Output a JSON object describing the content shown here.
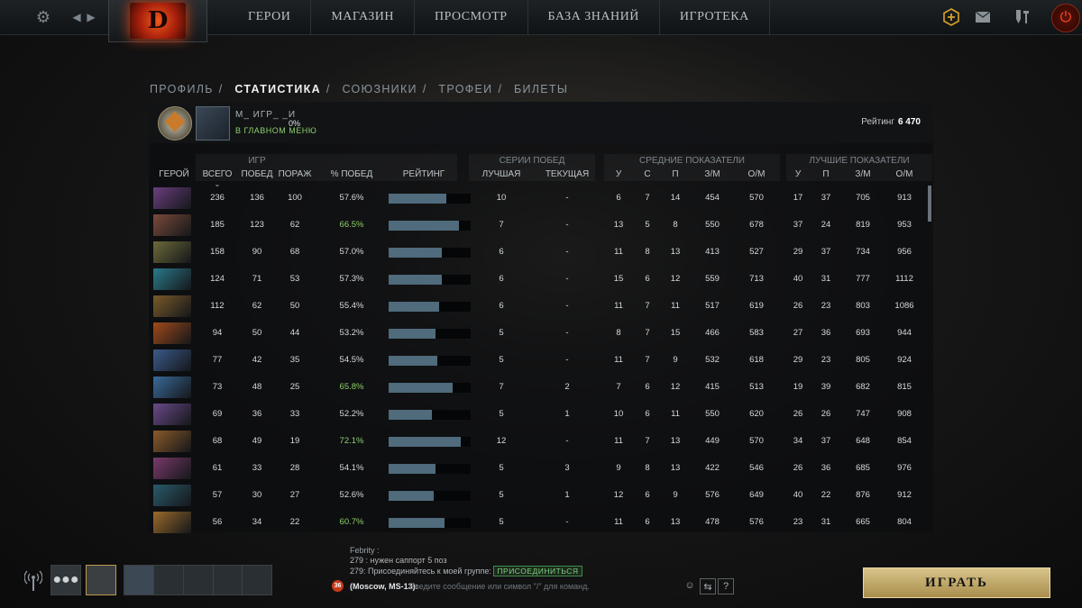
{
  "nav": {
    "items": [
      "ГЕРОИ",
      "МАГАЗИН",
      "ПРОСМОТР",
      "БАЗА ЗНАНИЙ",
      "ИГРОТЕКА"
    ]
  },
  "tabs": [
    "ПРОФИЛЬ",
    "СТАТИСТИКА",
    "СОЮЗНИКИ",
    "ТРОФЕИ",
    "БИЛЕТЫ"
  ],
  "active_tab": "СТАТИСТИКА",
  "profile": {
    "name_fragment": "М_ ИГР_ _И",
    "percent": "0%",
    "status": "В ГЛАВНОМ МЕНЮ",
    "rating_label": "Рейтинг",
    "rating_value": "6 470"
  },
  "groups": {
    "games": "ИГР",
    "streaks": "СЕРИИ ПОБЕД",
    "avg": "СРЕДНИЕ ПОКАЗАТЕЛИ",
    "best": "ЛУЧШИЕ ПОКАЗАТЕЛИ"
  },
  "headers": {
    "hero": "ГЕРОЙ",
    "total": "ВСЕГО",
    "wins": "ПОБЕД",
    "losses": "ПОРАЖ",
    "winrate": "% ПОБЕД",
    "rating": "РЕЙТИНГ",
    "best": "ЛУЧШАЯ",
    "current": "ТЕКУЩАЯ",
    "avg_k": "У",
    "avg_d": "С",
    "avg_a": "П",
    "avg_gpm": "З/М",
    "avg_xpm": "О/М",
    "best_k": "У",
    "best_a": "П",
    "best_gpm": "З/М",
    "best_xpm": "О/М"
  },
  "rows": [
    {
      "total": "236",
      "wins": "136",
      "losses": "100",
      "winrate": "57.6%",
      "rating": 0.7,
      "best": "10",
      "cur": "-",
      "k": "6",
      "d": "7",
      "a": "14",
      "gpm": "454",
      "xpm": "570",
      "bk": "17",
      "ba": "37",
      "bg": "705",
      "bx": "913",
      "hero_color": "#6a3f7e"
    },
    {
      "total": "185",
      "wins": "123",
      "losses": "62",
      "winrate": "66.5%",
      "rating": 0.86,
      "best": "7",
      "cur": "-",
      "k": "13",
      "d": "5",
      "a": "8",
      "gpm": "550",
      "xpm": "678",
      "bk": "37",
      "ba": "24",
      "bg": "819",
      "bx": "953",
      "hero_color": "#7a4a3a"
    },
    {
      "total": "158",
      "wins": "90",
      "losses": "68",
      "winrate": "57.0%",
      "rating": 0.65,
      "best": "6",
      "cur": "-",
      "k": "11",
      "d": "8",
      "a": "13",
      "gpm": "413",
      "xpm": "527",
      "bk": "29",
      "ba": "37",
      "bg": "734",
      "bx": "956",
      "hero_color": "#6d6a3a"
    },
    {
      "total": "124",
      "wins": "71",
      "losses": "53",
      "winrate": "57.3%",
      "rating": 0.65,
      "best": "6",
      "cur": "-",
      "k": "15",
      "d": "6",
      "a": "12",
      "gpm": "559",
      "xpm": "713",
      "bk": "40",
      "ba": "31",
      "bg": "777",
      "bx": "1112",
      "hero_color": "#2a7a8a"
    },
    {
      "total": "112",
      "wins": "62",
      "losses": "50",
      "winrate": "55.4%",
      "rating": 0.61,
      "best": "6",
      "cur": "-",
      "k": "11",
      "d": "7",
      "a": "11",
      "gpm": "517",
      "xpm": "619",
      "bk": "26",
      "ba": "23",
      "bg": "803",
      "bx": "1086",
      "hero_color": "#7a5a2a"
    },
    {
      "total": "94",
      "wins": "50",
      "losses": "44",
      "winrate": "53.2%",
      "rating": 0.57,
      "best": "5",
      "cur": "-",
      "k": "8",
      "d": "7",
      "a": "15",
      "gpm": "466",
      "xpm": "583",
      "bk": "27",
      "ba": "36",
      "bg": "693",
      "bx": "944",
      "hero_color": "#a04a1a"
    },
    {
      "total": "77",
      "wins": "42",
      "losses": "35",
      "winrate": "54.5%",
      "rating": 0.59,
      "best": "5",
      "cur": "-",
      "k": "11",
      "d": "7",
      "a": "9",
      "gpm": "532",
      "xpm": "618",
      "bk": "29",
      "ba": "23",
      "bg": "805",
      "bx": "924",
      "hero_color": "#3a5a8a"
    },
    {
      "total": "73",
      "wins": "48",
      "losses": "25",
      "winrate": "65.8%",
      "rating": 0.78,
      "best": "7",
      "cur": "2",
      "k": "7",
      "d": "6",
      "a": "12",
      "gpm": "415",
      "xpm": "513",
      "bk": "19",
      "ba": "39",
      "bg": "682",
      "bx": "815",
      "hero_color": "#3a6a9a"
    },
    {
      "total": "69",
      "wins": "36",
      "losses": "33",
      "winrate": "52.2%",
      "rating": 0.53,
      "best": "5",
      "cur": "1",
      "k": "10",
      "d": "6",
      "a": "11",
      "gpm": "550",
      "xpm": "620",
      "bk": "26",
      "ba": "26",
      "bg": "747",
      "bx": "908",
      "hero_color": "#6a4a8a"
    },
    {
      "total": "68",
      "wins": "49",
      "losses": "19",
      "winrate": "72.1%",
      "rating": 0.88,
      "best": "12",
      "cur": "-",
      "k": "11",
      "d": "7",
      "a": "13",
      "gpm": "449",
      "xpm": "570",
      "bk": "34",
      "ba": "37",
      "bg": "648",
      "bx": "854",
      "hero_color": "#8a5a2a"
    },
    {
      "total": "61",
      "wins": "33",
      "losses": "28",
      "winrate": "54.1%",
      "rating": 0.57,
      "best": "5",
      "cur": "3",
      "k": "9",
      "d": "8",
      "a": "13",
      "gpm": "422",
      "xpm": "546",
      "bk": "26",
      "ba": "36",
      "bg": "685",
      "bx": "976",
      "hero_color": "#7a3a6a"
    },
    {
      "total": "57",
      "wins": "30",
      "losses": "27",
      "winrate": "52.6%",
      "rating": 0.55,
      "best": "5",
      "cur": "1",
      "k": "12",
      "d": "6",
      "a": "9",
      "gpm": "576",
      "xpm": "649",
      "bk": "40",
      "ba": "22",
      "bg": "876",
      "bx": "912",
      "hero_color": "#2a5a6a"
    },
    {
      "total": "56",
      "wins": "34",
      "losses": "22",
      "winrate": "60.7%",
      "rating": 0.68,
      "best": "5",
      "cur": "-",
      "k": "11",
      "d": "6",
      "a": "13",
      "gpm": "478",
      "xpm": "576",
      "bk": "23",
      "ba": "31",
      "bg": "665",
      "bx": "804",
      "hero_color": "#9a6a2a"
    }
  ],
  "chat": {
    "line1_name": "Febrity :",
    "line2": "279  : нужен саппорт 5 поз",
    "line3": "279: Присоединяйтесь к моей группе:",
    "join_label": "ПРИСОЕДИНИТЬСЯ",
    "badge": "36",
    "channel": "(Moscow, MS-13):",
    "placeholder": "Введите сообщение или символ \"/\" для команд.",
    "help": "?"
  },
  "play_label": "ИГРАТЬ",
  "colors": {
    "winrate_high": "#8fcf6a",
    "winrate_normal": "#d6dadd",
    "bar": "#4f6b7c",
    "play_gold": "#c8b170"
  }
}
